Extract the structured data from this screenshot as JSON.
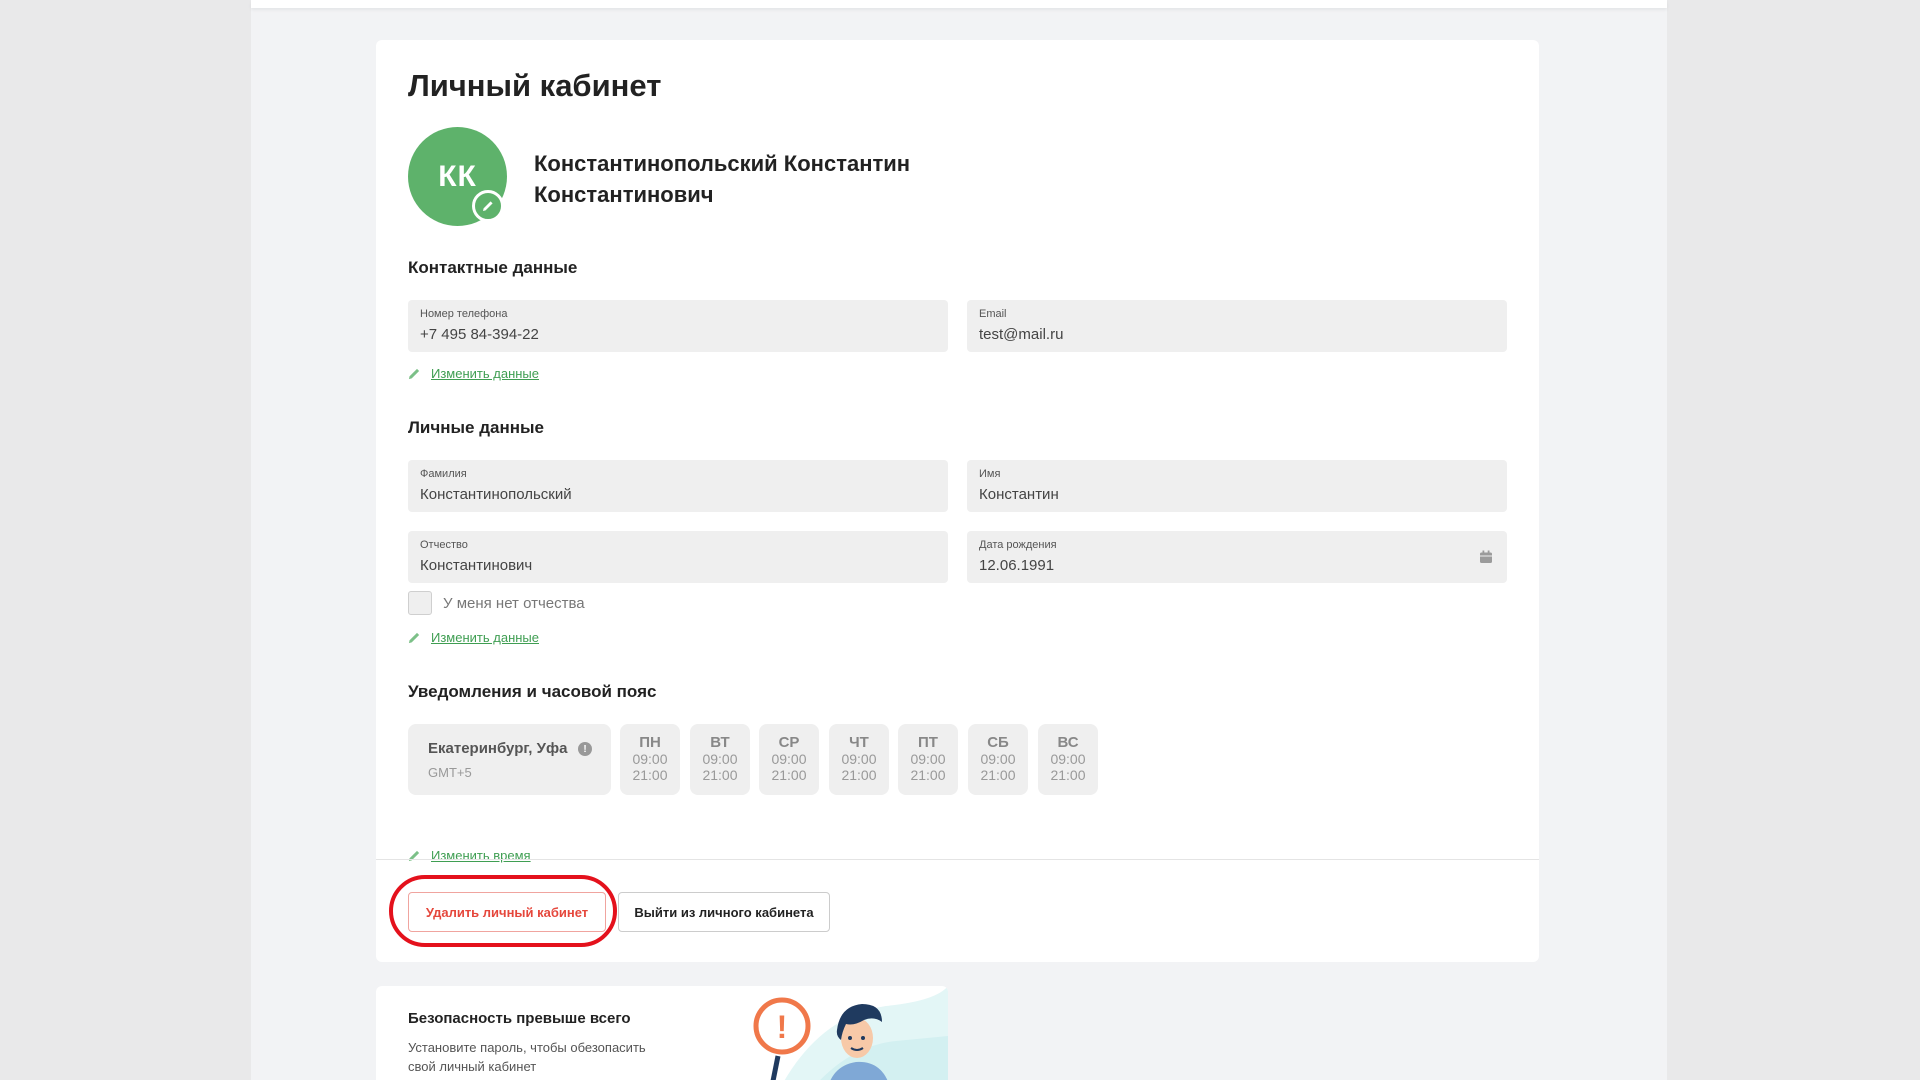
{
  "page": {
    "title": "Личный кабинет"
  },
  "profile": {
    "initials": "КК",
    "full_name": "Константинопольский Константин Константинович"
  },
  "contacts": {
    "section_title": "Контактные данные",
    "phone_label": "Номер телефона",
    "phone_value": "+7 495 84-394-22",
    "email_label": "Email",
    "email_value": "test@mail.ru",
    "edit_label": "Изменить данные"
  },
  "personal": {
    "section_title": "Личные данные",
    "surname_label": "Фамилия",
    "surname_value": "Константинопольский",
    "name_label": "Имя",
    "name_value": "Константин",
    "patronymic_label": "Отчество",
    "patronymic_value": "Константинович",
    "birth_label": "Дата рождения",
    "birth_value": "12.06.1991",
    "no_patronymic_label": "У меня нет отчества",
    "no_patronymic_checked": false,
    "edit_label": "Изменить данные"
  },
  "notifications": {
    "section_title": "Уведомления и часовой пояс",
    "timezone_city": "Екатеринбург, Уфа",
    "timezone_info": "!",
    "timezone_gmt": "GMT+5",
    "days": [
      {
        "day": "ПН",
        "from": "09:00",
        "to": "21:00"
      },
      {
        "day": "ВТ",
        "from": "09:00",
        "to": "21:00"
      },
      {
        "day": "СР",
        "from": "09:00",
        "to": "21:00"
      },
      {
        "day": "ЧТ",
        "from": "09:00",
        "to": "21:00"
      },
      {
        "day": "ПТ",
        "from": "09:00",
        "to": "21:00"
      },
      {
        "day": "СБ",
        "from": "09:00",
        "to": "21:00"
      },
      {
        "day": "ВС",
        "from": "09:00",
        "to": "21:00"
      }
    ],
    "edit_label": "Изменить время"
  },
  "actions": {
    "delete_label": "Удалить личный кабинет",
    "logout_label": "Выйти из личного кабинета"
  },
  "security": {
    "title": "Безопасность превыше всего",
    "text": "Установите пароль, чтобы обезопасить свой личный кабинет",
    "sign_mark": "!"
  },
  "colors": {
    "accent_green": "#5eb26b",
    "link_green": "#3f9e52",
    "danger_red": "#e5473c",
    "highlight_red": "#e4111c"
  },
  "icons": {
    "avatar_edit": "pencil-icon",
    "edit_link": "pencil-icon",
    "birth_date": "calendar-icon",
    "timezone_info": "info-icon"
  }
}
